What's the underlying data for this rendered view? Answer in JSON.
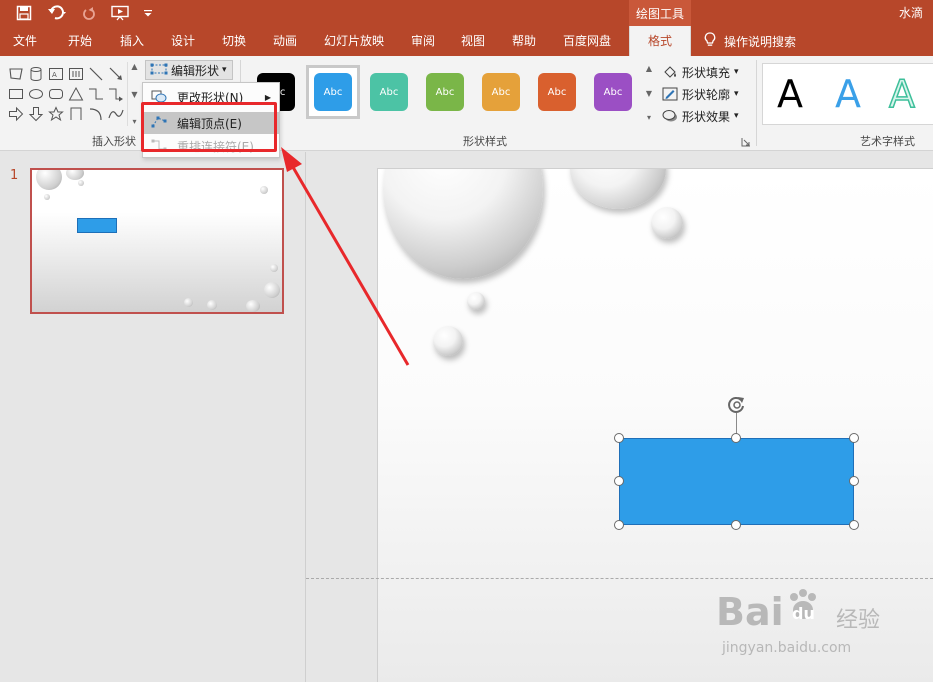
{
  "titlebar": {
    "context_tab": "绘图工具",
    "doc_name": "水滴"
  },
  "tabs": [
    {
      "label": "文件"
    },
    {
      "label": "开始"
    },
    {
      "label": "插入"
    },
    {
      "label": "设计"
    },
    {
      "label": "切换"
    },
    {
      "label": "动画"
    },
    {
      "label": "幻灯片放映"
    },
    {
      "label": "审阅"
    },
    {
      "label": "视图"
    },
    {
      "label": "帮助"
    },
    {
      "label": "百度网盘"
    },
    {
      "label": "格式"
    }
  ],
  "tell_me": "操作说明搜索",
  "ribbon": {
    "edit_shape_label": "编辑形状",
    "group_insert_shapes": "插入形状",
    "group_shape_styles": "形状样式",
    "group_wordart": "艺术字样式",
    "style_thumb_text": "Abc",
    "shape_fill": "形状填充",
    "shape_outline": "形状轮廓",
    "shape_effects": "形状效果",
    "wordart_letter": "A"
  },
  "dropdown": {
    "change_shape": "更改形状(N)",
    "edit_points": "编辑顶点(E)",
    "reroute_connectors": "重排连接符(E)"
  },
  "slides": {
    "number": "1"
  },
  "watermark": {
    "main": "Bai",
    "paw": "du",
    "cn": "经验",
    "sub": "jingyan.baidu.com"
  },
  "colors": {
    "accent": "#b7472a",
    "shape_fill": "#2e9de8",
    "annotation": "#e8282b",
    "style_black": "#000000",
    "style_blue": "#2e9de8",
    "style_teal": "#4cc3a5",
    "style_green": "#7ab648",
    "style_gold": "#e5a13a",
    "style_orange": "#d9602e",
    "style_purple": "#9b4fc4"
  }
}
